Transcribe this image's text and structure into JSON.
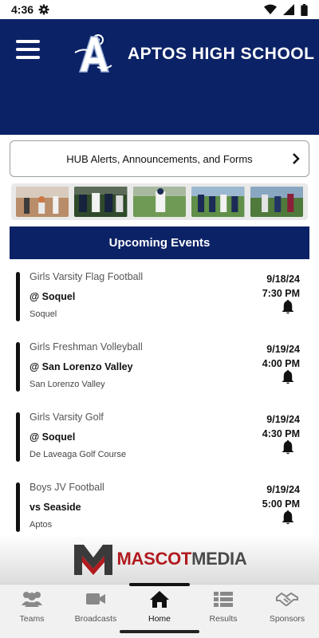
{
  "status_bar": {
    "time": "4:36",
    "icons": [
      "settings-gear-icon",
      "wifi-icon",
      "signal-icon",
      "battery-icon"
    ]
  },
  "header": {
    "school_name": "APTOS HIGH SCHOOL",
    "background_color": "#0b2266",
    "logo": "aptos-a-logo"
  },
  "alerts_button": {
    "label": "HUB Alerts, Announcements, and Forms"
  },
  "photo_strip": {
    "photos": [
      "basketball-photo",
      "football-photo",
      "baseball-photo",
      "soccer-photo",
      "running-photo"
    ]
  },
  "upcoming_events": {
    "title": "Upcoming Events",
    "events": [
      {
        "sport": "Girls Varsity Flag Football",
        "opponent": "@ Soquel",
        "location": "Soquel",
        "date": "9/18/24",
        "time": "7:30 PM"
      },
      {
        "sport": "Girls Freshman Volleyball",
        "opponent": "@ San Lorenzo Valley",
        "location": "San Lorenzo Valley",
        "date": "9/19/24",
        "time": "4:00 PM"
      },
      {
        "sport": "Girls Varsity Golf",
        "opponent": "@ Soquel",
        "location": "De Laveaga Golf Course",
        "date": "9/19/24",
        "time": "4:30 PM"
      },
      {
        "sport": "Boys JV Football",
        "opponent": "vs Seaside",
        "location": "Aptos",
        "date": "9/19/24",
        "time": "5:00 PM"
      }
    ]
  },
  "sponsor": {
    "name_part1": "MASCOT",
    "name_part2": "MEDIA",
    "accent_color": "#b11a1e"
  },
  "tabs": [
    {
      "label": "Teams",
      "icon": "teams-icon",
      "active": false
    },
    {
      "label": "Broadcasts",
      "icon": "video-camera-icon",
      "active": false
    },
    {
      "label": "Home",
      "icon": "home-icon",
      "active": true
    },
    {
      "label": "Results",
      "icon": "results-list-icon",
      "active": false
    },
    {
      "label": "Sponsors",
      "icon": "handshake-icon",
      "active": false
    }
  ]
}
